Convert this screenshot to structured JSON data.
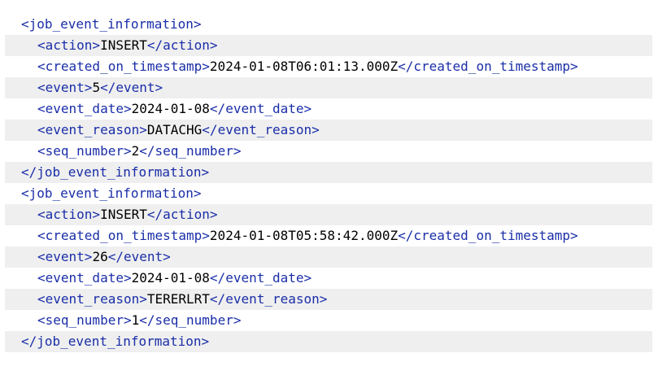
{
  "records": [
    {
      "root_open": "<job_event_information>",
      "fields": [
        {
          "open": "<action>",
          "value": "INSERT",
          "close": "</action>"
        },
        {
          "open": "<created_on_timestamp>",
          "value": "2024-01-08T06:01:13.000Z",
          "close": "</created_on_timestamp>"
        },
        {
          "open": "<event>",
          "value": "5",
          "close": "</event>"
        },
        {
          "open": "<event_date>",
          "value": "2024-01-08",
          "close": "</event_date>"
        },
        {
          "open": "<event_reason>",
          "value": "DATACHG",
          "close": "</event_reason>"
        },
        {
          "open": "<seq_number>",
          "value": "2",
          "close": "</seq_number>"
        }
      ],
      "root_close": "</job_event_information>"
    },
    {
      "root_open": "<job_event_information>",
      "fields": [
        {
          "open": "<action>",
          "value": "INSERT",
          "close": "</action>"
        },
        {
          "open": "<created_on_timestamp>",
          "value": "2024-01-08T05:58:42.000Z",
          "close": "</created_on_timestamp>"
        },
        {
          "open": "<event>",
          "value": "26",
          "close": "</event>"
        },
        {
          "open": "<event_date>",
          "value": "2024-01-08",
          "close": "</event_date>"
        },
        {
          "open": "<event_reason>",
          "value": "TERERLRT",
          "close": "</event_reason>"
        },
        {
          "open": "<seq_number>",
          "value": "1",
          "close": "</seq_number>"
        }
      ],
      "root_close": "</job_event_information>"
    }
  ],
  "colors": {
    "tag": "#1a2ea8",
    "value": "#000000",
    "stripe": "#efefef",
    "background": "#ffffff"
  }
}
